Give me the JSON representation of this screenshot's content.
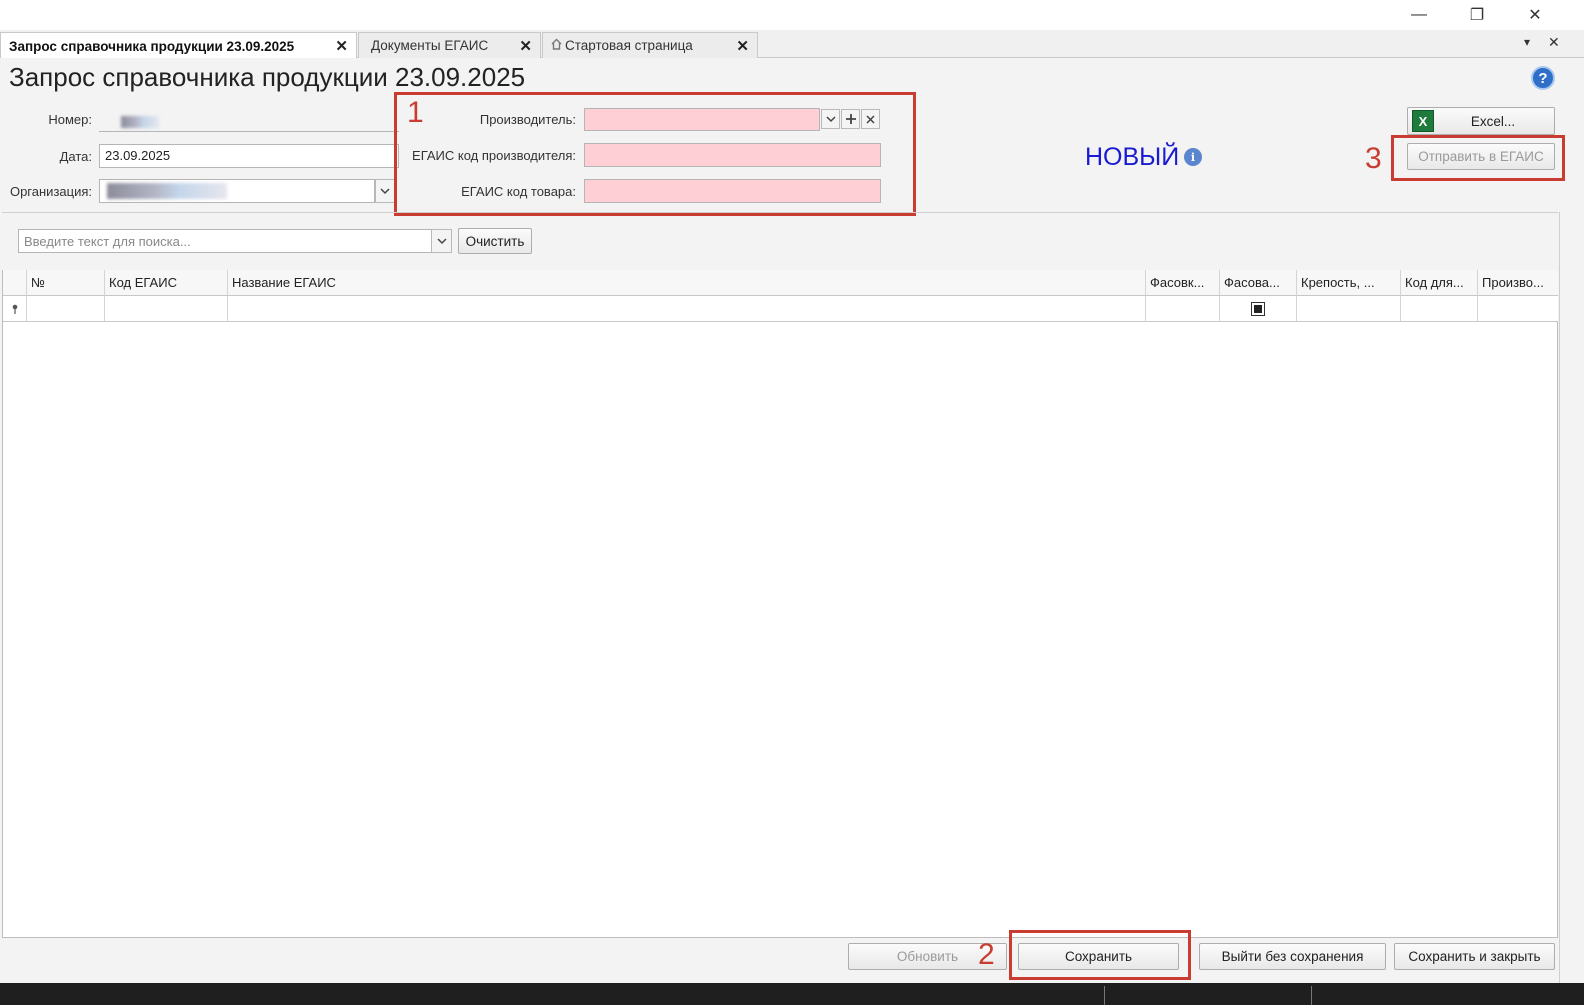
{
  "window": {
    "minimize": "—",
    "restore": "❐",
    "close": "✕"
  },
  "tabs": [
    {
      "label": "Запрос справочника продукции 23.09.2025",
      "close": "✕"
    },
    {
      "label": "Документы ЕГАИС",
      "close": "✕"
    },
    {
      "label": "Стартовая страница",
      "close": "✕"
    }
  ],
  "tabstrip": {
    "dropdown": "▾",
    "close": "✕"
  },
  "page": {
    "title": "Запрос справочника продукции 23.09.2025",
    "help": "?"
  },
  "form": {
    "number_label": "Номер:",
    "date_label": "Дата:",
    "date_value": "23.09.2025",
    "org_label": "Организация:",
    "producer_label": "Производитель:",
    "producer_code_label": "ЕГАИС код производителя:",
    "product_code_label": "ЕГАИС код товара:"
  },
  "status": {
    "text": "НОВЫЙ"
  },
  "buttons": {
    "excel": "Excel...",
    "send": "Отправить в ЕГАИС",
    "clear": "Очистить",
    "refresh": "Обновить",
    "save": "Сохранить",
    "exit_nosave": "Выйти без сохранения",
    "save_close": "Сохранить и закрыть"
  },
  "search": {
    "placeholder": "Введите текст для поиска..."
  },
  "annotations": [
    "1",
    "2",
    "3"
  ],
  "table": {
    "columns": [
      "№",
      "Код ЕГАИС",
      "Название ЕГАИС",
      "Фасовк...",
      "Фасова...",
      "Крепость, ...",
      "Код для...",
      "Произво..."
    ]
  },
  "colors": {
    "required_field": "#ffcfd6",
    "annotation": "#c93c32",
    "status": "#1a1ad0",
    "help": "#2f6fc8"
  }
}
